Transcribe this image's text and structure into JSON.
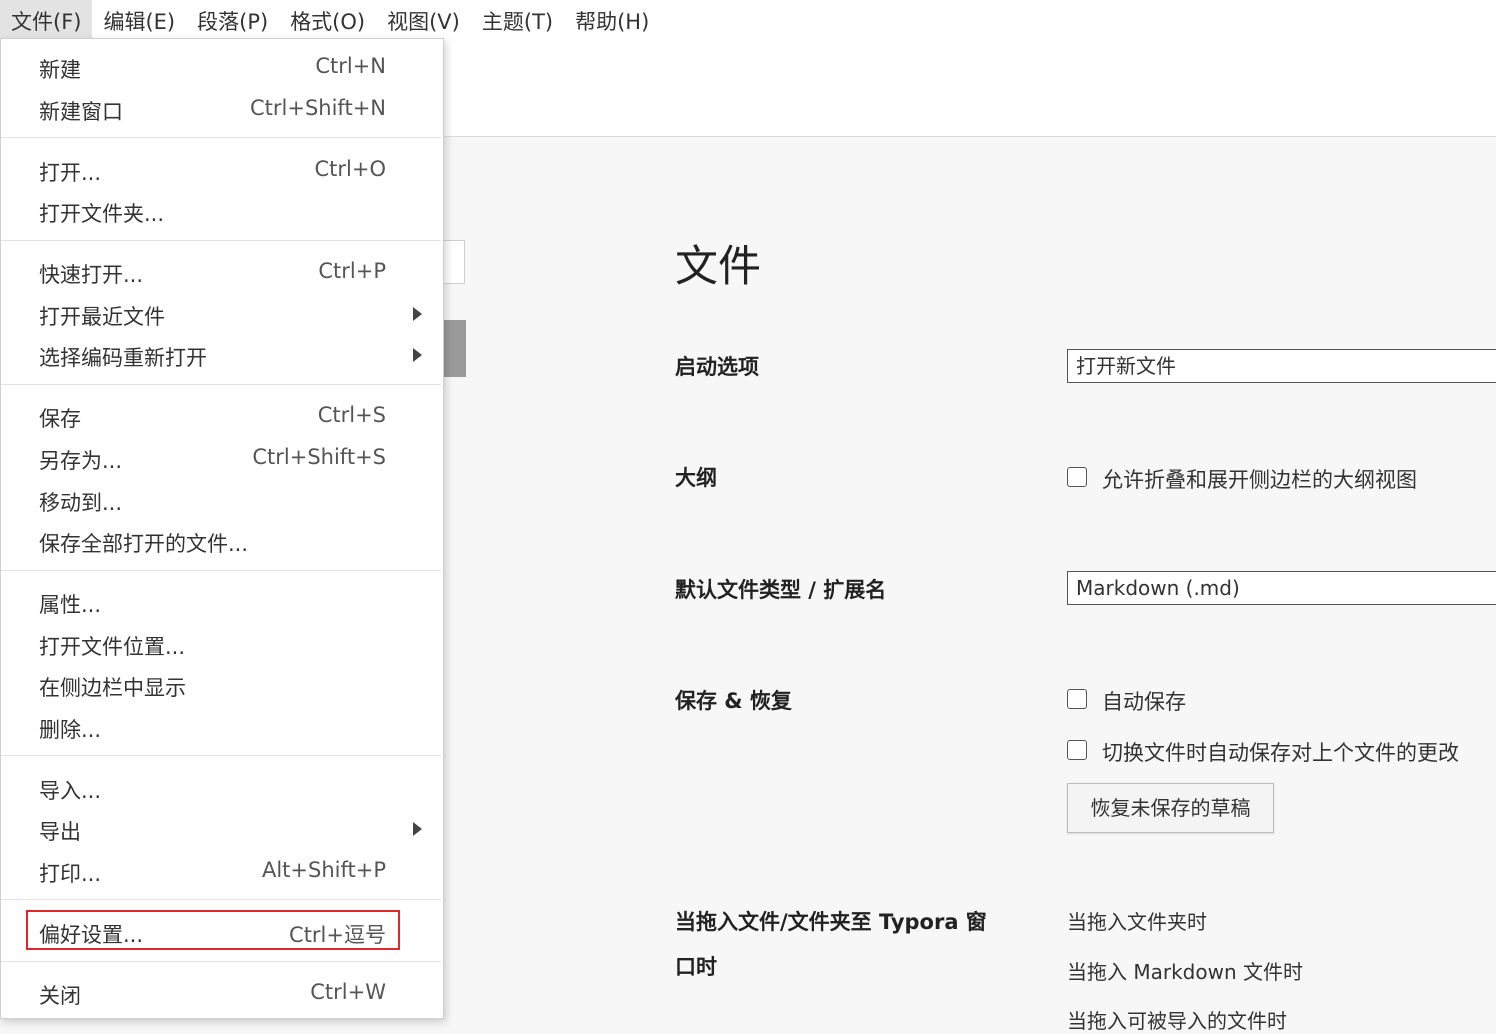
{
  "menubar": {
    "items": [
      "文件(F)",
      "编辑(E)",
      "段落(P)",
      "格式(O)",
      "视图(V)",
      "主题(T)",
      "帮助(H)"
    ]
  },
  "file_menu": {
    "new": {
      "label": "新建",
      "shortcut": "Ctrl+N"
    },
    "new_window": {
      "label": "新建窗口",
      "shortcut": "Ctrl+Shift+N"
    },
    "open": {
      "label": "打开...",
      "shortcut": "Ctrl+O"
    },
    "open_folder": {
      "label": "打开文件夹..."
    },
    "quick_open": {
      "label": "快速打开...",
      "shortcut": "Ctrl+P"
    },
    "open_recent": {
      "label": "打开最近文件"
    },
    "reopen_encoding": {
      "label": "选择编码重新打开"
    },
    "save": {
      "label": "保存",
      "shortcut": "Ctrl+S"
    },
    "save_as": {
      "label": "另存为...",
      "shortcut": "Ctrl+Shift+S"
    },
    "move_to": {
      "label": "移动到..."
    },
    "save_all": {
      "label": "保存全部打开的文件..."
    },
    "properties": {
      "label": "属性..."
    },
    "open_location": {
      "label": "打开文件位置..."
    },
    "reveal_sidebar": {
      "label": "在侧边栏中显示"
    },
    "delete": {
      "label": "删除..."
    },
    "import": {
      "label": "导入..."
    },
    "export": {
      "label": "导出"
    },
    "print": {
      "label": "打印...",
      "shortcut": "Alt+Shift+P"
    },
    "preferences": {
      "label": "偏好设置...",
      "shortcut": "Ctrl+逗号"
    },
    "close": {
      "label": "关闭",
      "shortcut": "Ctrl+W"
    }
  },
  "prefs": {
    "title": "文件",
    "startup": {
      "label": "启动选项",
      "value": "打开新文件"
    },
    "outline": {
      "label": "大纲",
      "checkbox": "允许折叠和展开侧边栏的大纲视图",
      "checked": false
    },
    "default_type": {
      "label": "默认文件类型 / 扩展名",
      "value": "Markdown (.md)"
    },
    "save_restore": {
      "label": "保存 & 恢复",
      "autosave": "自动保存",
      "autosave_checked": false,
      "autosave_switch": "切换文件时自动保存对上个文件的更改",
      "autosave_switch_checked": false,
      "recover_button": "恢复未保存的草稿"
    },
    "drag_drop": {
      "label_line1": "当拖入文件/文件夹至 Typora 窗",
      "label_line2": "口时",
      "folder": "当拖入文件夹时",
      "markdown": "当拖入 Markdown 文件时",
      "importable": "当拖入可被导入的文件时"
    }
  },
  "colors": {
    "highlight": "#e0272f",
    "background": "#f7f7f7"
  }
}
